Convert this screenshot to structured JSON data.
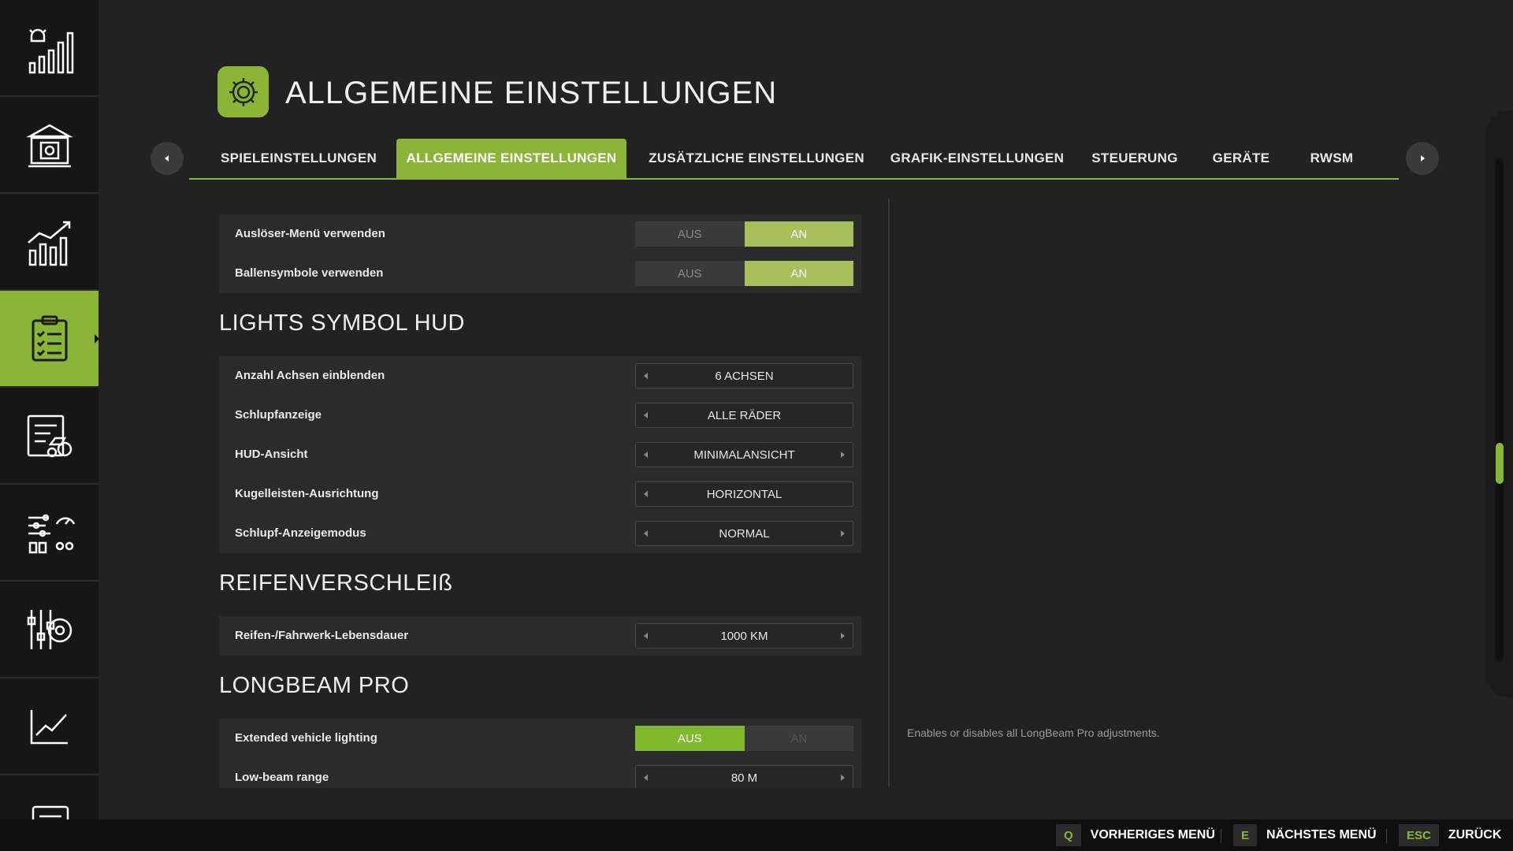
{
  "header": {
    "title": "ALLGEMEINE EINSTELLUNGEN"
  },
  "tabs": [
    {
      "label": "SPIELEINSTELLUNGEN",
      "active": false
    },
    {
      "label": "ALLGEMEINE EINSTELLUNGEN",
      "active": true
    },
    {
      "label": "ZUSÄTZLICHE EINSTELLUNGEN",
      "active": false
    },
    {
      "label": "GRAFIK-EINSTELLUNGEN",
      "active": false
    },
    {
      "label": "STEUERUNG",
      "active": false
    },
    {
      "label": "GERÄTE",
      "active": false
    },
    {
      "label": "RWSM",
      "active": false
    }
  ],
  "sidebar": {
    "items": [
      {
        "icon": "price-alarm-icon"
      },
      {
        "icon": "bank-icon"
      },
      {
        "icon": "statistics-icon"
      },
      {
        "icon": "clipboard-checklist-icon",
        "active": true
      },
      {
        "icon": "vehicle-list-icon"
      },
      {
        "icon": "sliders-gauge-icon"
      },
      {
        "icon": "settings-gear-sliders-icon"
      },
      {
        "icon": "line-chart-icon"
      },
      {
        "icon": "list-icon"
      }
    ]
  },
  "settings": {
    "trigger_menu": {
      "label": "Auslöser-Menü verwenden",
      "off": "AUS",
      "on": "AN",
      "value": "AN"
    },
    "bale_symbols": {
      "label": "Ballensymbole verwenden",
      "off": "AUS",
      "on": "AN",
      "value": "AN"
    },
    "lights_section": "LIGHTS SYMBOL HUD",
    "axles": {
      "label": "Anzahl Achsen einblenden",
      "value": "6 ACHSEN"
    },
    "slip_display": {
      "label": "Schlupfanzeige",
      "value": "ALLE RÄDER"
    },
    "hud_view": {
      "label": "HUD-Ansicht",
      "value": "MINIMALANSICHT"
    },
    "ball_orientation": {
      "label": "Kugelleisten-Ausrichtung",
      "value": "HORIZONTAL"
    },
    "slip_mode": {
      "label": "Schlupf-Anzeigemodus",
      "value": "NORMAL"
    },
    "tire_section": "REIFENVERSCHLEIß",
    "tire_life": {
      "label": "Reifen-/Fahrwerk-Lebensdauer",
      "value": "1000 KM"
    },
    "longbeam_section": "LONGBEAM PRO",
    "ext_lighting": {
      "label": "Extended vehicle lighting",
      "off": "AUS",
      "on": "AN",
      "value": "AUS"
    },
    "low_beam": {
      "label": "Low-beam range",
      "value": "80 M"
    }
  },
  "description": "Enables or disables all LongBeam Pro adjustments.",
  "bottom": {
    "prev": {
      "key": "Q",
      "label": "VORHERIGES MENÜ"
    },
    "next": {
      "key": "E",
      "label": "NÄCHSTES MENÜ"
    },
    "back": {
      "key": "ESC",
      "label": "ZURÜCK"
    }
  },
  "colors": {
    "accent": "#8ab536",
    "toggle_on_soft": "#a8be5a",
    "background": "#222222",
    "sidebar": "#161616"
  }
}
